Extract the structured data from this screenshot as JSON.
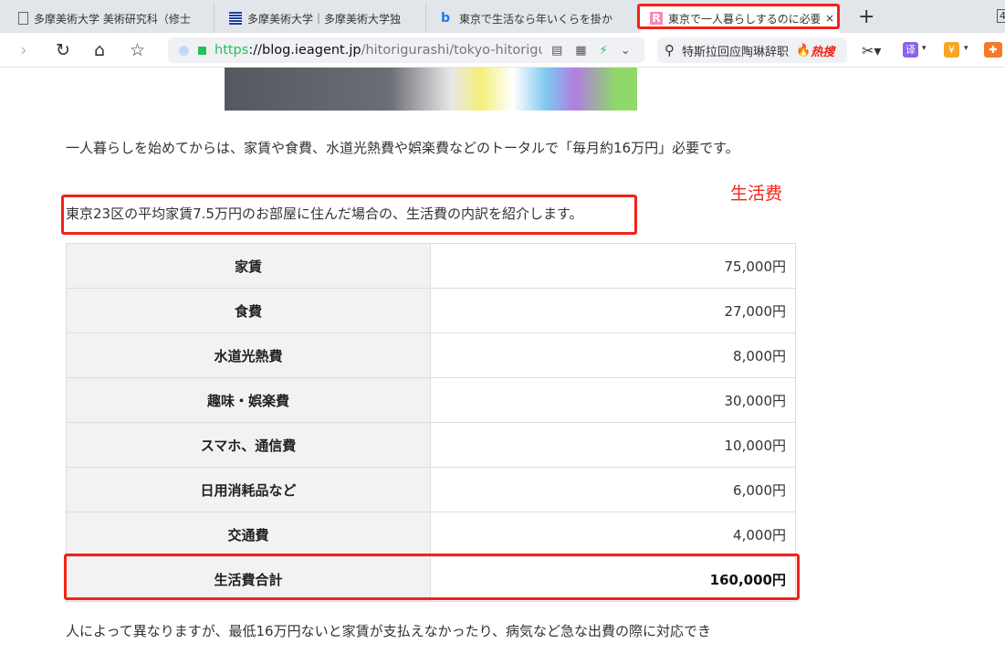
{
  "tabs": [
    {
      "title": "多摩美術大学 美術研究科（修士",
      "icon": "page-icon"
    },
    {
      "title": "多摩美術大学｜多摩美術大学独",
      "icon": "university-logo-icon"
    },
    {
      "title": "東京で生活なら年いくらを掛か",
      "icon": "bing-icon"
    },
    {
      "title": "東京で一人暮らしするのに必要",
      "icon": "r-logo-icon",
      "active": true
    }
  ],
  "new_tab": "+",
  "tab_count": "4",
  "url": {
    "scheme": "https",
    "host": "://blog.ieagent.jp",
    "path": "/hitorigurashi/tokyo-hitorigu"
  },
  "search": {
    "value": "特斯拉回应陶琳辞职",
    "hot": "热搜"
  },
  "extensions": {
    "translate": "译",
    "wallet": "¥"
  },
  "article": {
    "intro": "一人暮らしを始めてからは、家賃や食費、水道光熱費や娯楽費などのトータルで「毎月約16万円」必要です。",
    "annotation": "生活费",
    "highlight": "東京23区の平均家賃7.5万円のお部屋に住んだ場合の、生活費の内訳を紹介します。",
    "table": [
      {
        "item": "家賃",
        "amount": "75,000円"
      },
      {
        "item": "食費",
        "amount": "27,000円"
      },
      {
        "item": "水道光熱費",
        "amount": "8,000円"
      },
      {
        "item": "趣味・娯楽費",
        "amount": "30,000円"
      },
      {
        "item": "スマホ、通信費",
        "amount": "10,000円"
      },
      {
        "item": "日用消耗品など",
        "amount": "6,000円"
      },
      {
        "item": "交通費",
        "amount": "4,000円"
      }
    ],
    "total": {
      "item": "生活費合計",
      "amount": "160,000円"
    },
    "outro": "人によって異なりますが、最低16万円ないと家賃が支払えなかったり、病気など急な出費の際に対応でき"
  },
  "colors": {
    "highlight": "#f3221a",
    "secure": "#1fc25b"
  }
}
